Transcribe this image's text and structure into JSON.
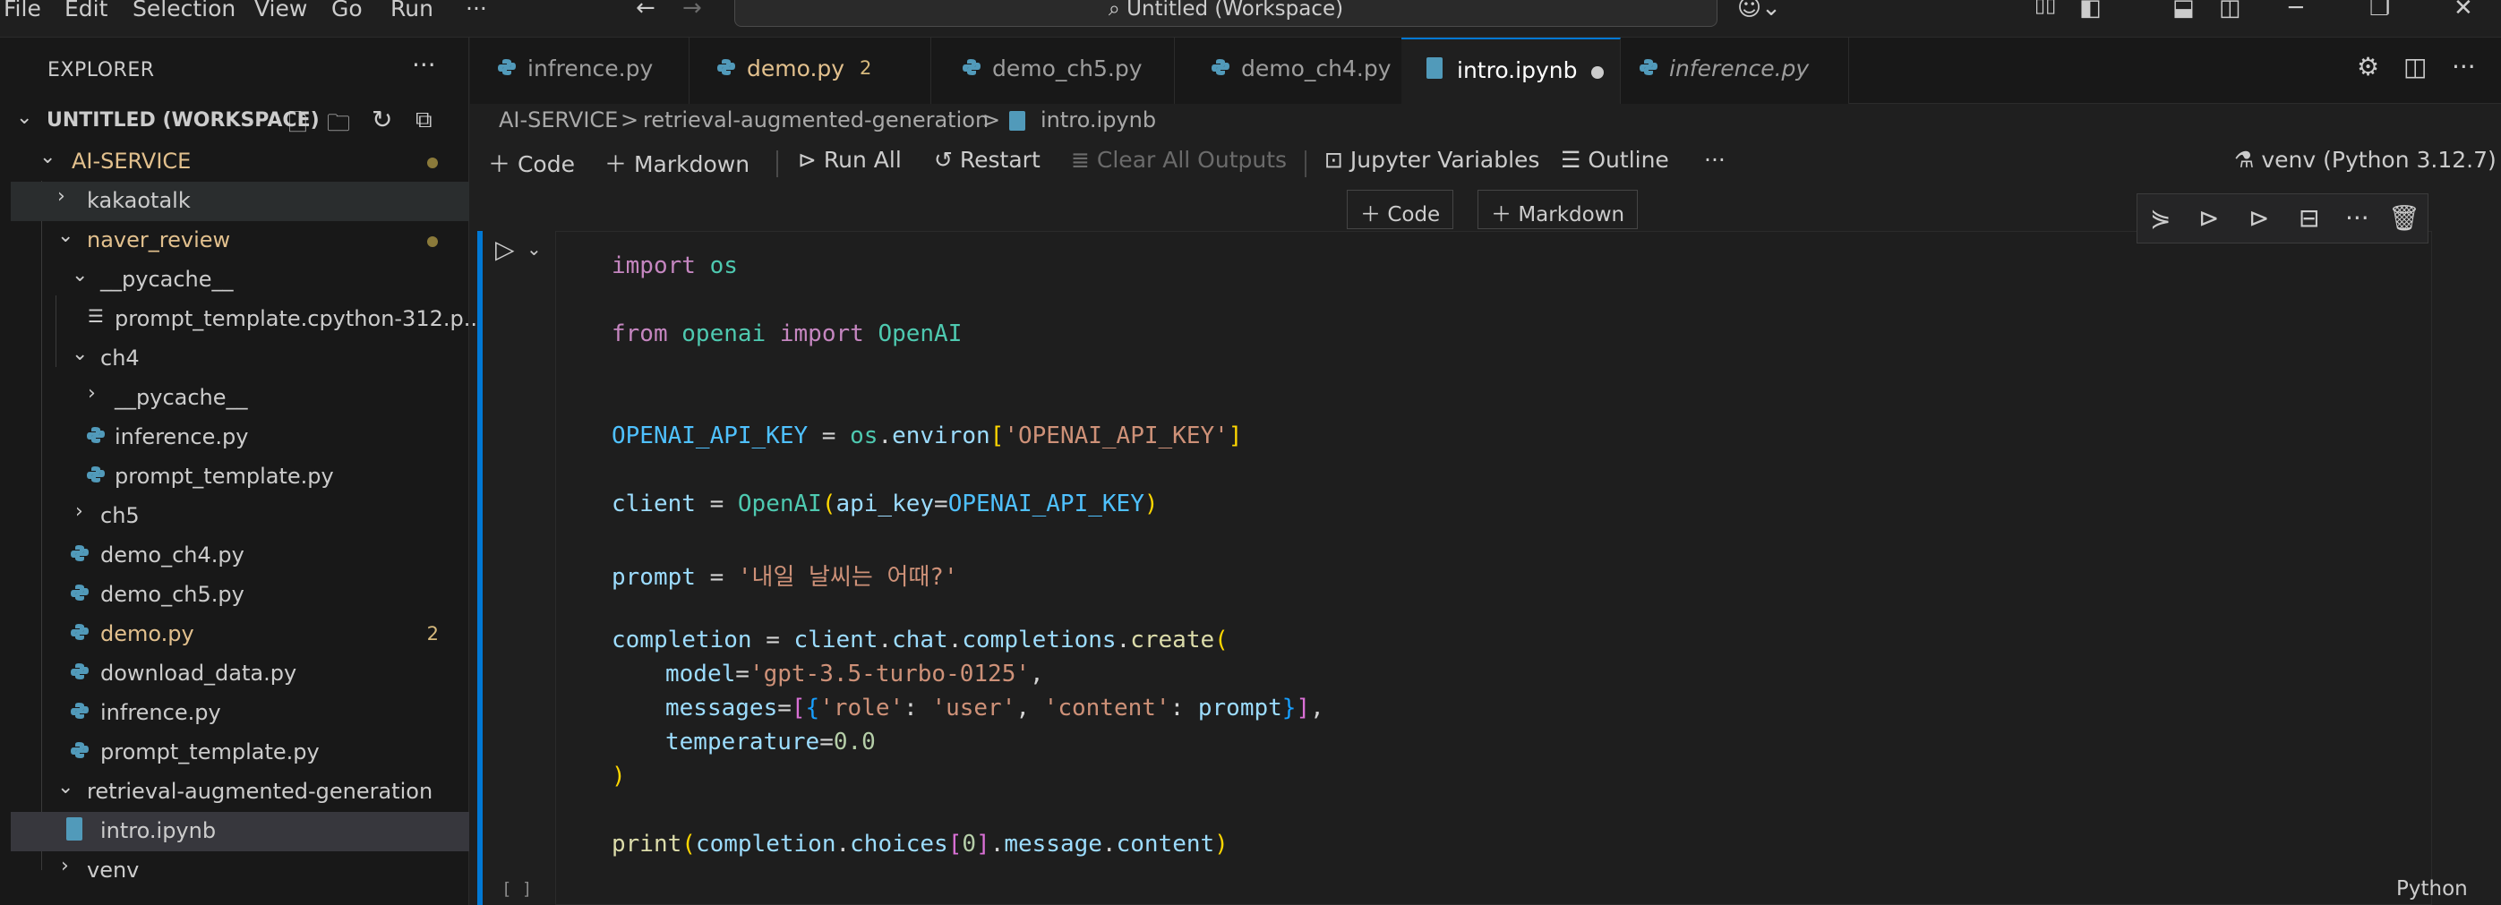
{
  "menu": [
    "File",
    "Edit",
    "Selection",
    "View",
    "Go",
    "Run",
    "···"
  ],
  "command_center": {
    "label": "Untitled (Workspace)"
  },
  "explorer": {
    "title": "EXPLORER",
    "more": "···",
    "workspace": "UNTITLED (WORKSPACE)",
    "tree": [
      {
        "label": "AI-SERVICE",
        "modified": true
      },
      {
        "label": "kakaotalk"
      },
      {
        "label": "naver_review",
        "modified": true
      },
      {
        "label": "__pycache__"
      },
      {
        "label": "prompt_template.cpython-312.p..."
      },
      {
        "label": "ch4"
      },
      {
        "label": "__pycache__"
      },
      {
        "label": "inference.py"
      },
      {
        "label": "prompt_template.py"
      },
      {
        "label": "ch5"
      },
      {
        "label": "demo_ch4.py"
      },
      {
        "label": "demo_ch5.py"
      },
      {
        "label": "demo.py",
        "badge": "2",
        "modified": true
      },
      {
        "label": "download_data.py"
      },
      {
        "label": "infrence.py"
      },
      {
        "label": "prompt_template.py"
      },
      {
        "label": "retrieval-augmented-generation"
      },
      {
        "label": "intro.ipynb"
      },
      {
        "label": "venv"
      }
    ]
  },
  "tabs": [
    {
      "label": "infrence.py"
    },
    {
      "label": "demo.py",
      "count": "2"
    },
    {
      "label": "demo_ch5.py"
    },
    {
      "label": "demo_ch4.py"
    },
    {
      "label": "intro.ipynb"
    },
    {
      "label": "inference.py"
    }
  ],
  "breadcrumb": [
    "AI-SERVICE",
    ">",
    "retrieval-augmented-generation",
    ">",
    "intro.ipynb"
  ],
  "notebook_toolbar": {
    "code": "Code",
    "markdown": "Markdown",
    "run_all": "Run All",
    "restart": "Restart",
    "clear_outputs": "Clear All Outputs",
    "variables": "Jupyter Variables",
    "outline": "Outline",
    "more": "···",
    "kernel": "venv (Python 3.12.7)"
  },
  "insert_bar": {
    "code": "Code",
    "markdown": "Markdown"
  },
  "cell": {
    "exec_count": "[ ]",
    "language": "Python",
    "code": {
      "l1": [
        "import",
        "os"
      ],
      "l2": [
        "from",
        "openai",
        "import",
        "OpenAI"
      ],
      "l3": [
        "OPENAI_API_KEY",
        " = ",
        "os",
        ".",
        "environ",
        "[",
        "'OPENAI_API_KEY'",
        "]"
      ],
      "l4": [
        "client",
        " = ",
        "OpenAI",
        "(",
        "api_key",
        "=",
        "OPENAI_API_KEY",
        ")"
      ],
      "l5": [
        "prompt",
        " = ",
        "'내일 날씨는 어때?'"
      ],
      "l6": [
        "completion",
        " = ",
        "client",
        ".",
        "chat",
        ".",
        "completions",
        ".",
        "create",
        "("
      ],
      "l7": [
        "model",
        "=",
        "'gpt-3.5-turbo-0125'",
        ","
      ],
      "l8": [
        "messages",
        "=",
        "[",
        "{",
        "'role'",
        ": ",
        "'user'",
        ", ",
        "'content'",
        ": ",
        "prompt",
        "}",
        "]",
        ","
      ],
      "l9": [
        "temperature",
        "=",
        "0.0"
      ],
      "l10": [
        ")"
      ],
      "l11": [
        "print",
        "(",
        "completion",
        ".",
        "choices",
        "[",
        "0",
        "]",
        ".",
        "message",
        ".",
        "content",
        ")"
      ]
    }
  },
  "colors": {
    "accent": "#0078d4",
    "modified": "#e2c08d",
    "keyword": "#c586c0",
    "string": "#ce9178",
    "class": "#4ec9b0"
  }
}
